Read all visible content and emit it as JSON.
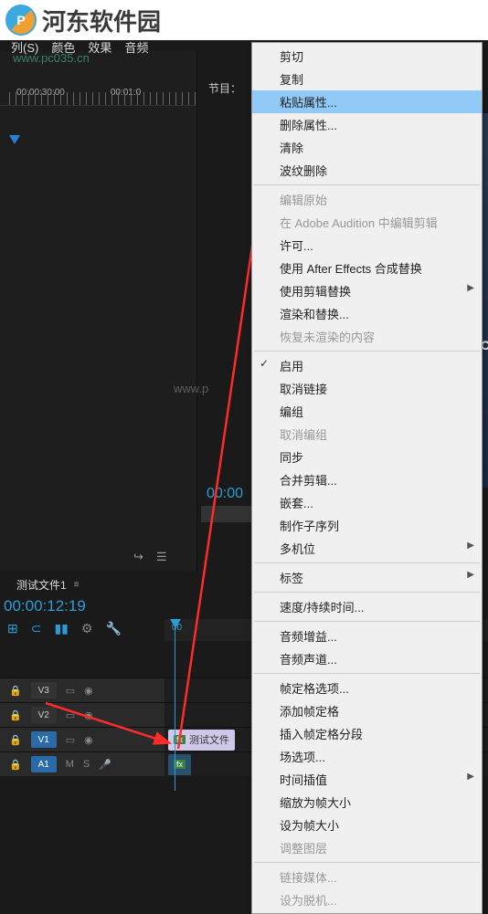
{
  "logo": {
    "text": "河东软件园"
  },
  "watermark": {
    "url1": "www.pc035.cn",
    "url2": "www.p"
  },
  "menubar": {
    "items": [
      "列(S)",
      "颜色",
      "效果",
      "音频"
    ]
  },
  "program": {
    "label": "节目："
  },
  "ruler": {
    "t1": "00:00:30:00",
    "t2": "00:01:0"
  },
  "big_time": "00:00",
  "sequence": {
    "tab": "测试文件1",
    "close": "≡"
  },
  "timeline": {
    "time": "00:00:12:19",
    "ruler0": "00"
  },
  "tracks": {
    "v3": "V3",
    "v2": "V2",
    "v1": "V1",
    "a1": "A1",
    "eye": "◉",
    "lock": "🔒",
    "m": "M",
    "s": "S",
    "mic": "🎤"
  },
  "clip": {
    "name": "测试文件",
    "fx": "fx"
  },
  "video_side": "C",
  "context_menu": {
    "items": [
      {
        "label": "剪切"
      },
      {
        "label": "复制"
      },
      {
        "label": "粘贴属性...",
        "hl": true
      },
      {
        "label": "删除属性..."
      },
      {
        "label": "清除"
      },
      {
        "label": "波纹删除"
      },
      {
        "sep": true
      },
      {
        "label": "编辑原始",
        "dis": true
      },
      {
        "label": "在 Adobe Audition 中编辑剪辑",
        "dis": true
      },
      {
        "label": "许可..."
      },
      {
        "label": "使用 After Effects 合成替换"
      },
      {
        "label": "使用剪辑替换",
        "sub": true
      },
      {
        "label": "渲染和替换..."
      },
      {
        "label": "恢复未渲染的内容",
        "dis": true
      },
      {
        "sep": true
      },
      {
        "label": "启用",
        "check": true
      },
      {
        "label": "取消链接"
      },
      {
        "label": "编组"
      },
      {
        "label": "取消编组",
        "dis": true
      },
      {
        "label": "同步"
      },
      {
        "label": "合并剪辑..."
      },
      {
        "label": "嵌套..."
      },
      {
        "label": "制作子序列"
      },
      {
        "label": "多机位",
        "sub": true
      },
      {
        "sep": true
      },
      {
        "label": "标签",
        "sub": true
      },
      {
        "sep": true
      },
      {
        "label": "速度/持续时间..."
      },
      {
        "sep": true
      },
      {
        "label": "音频增益..."
      },
      {
        "label": "音频声道..."
      },
      {
        "sep": true
      },
      {
        "label": "帧定格选项..."
      },
      {
        "label": "添加帧定格"
      },
      {
        "label": "插入帧定格分段"
      },
      {
        "label": "场选项..."
      },
      {
        "label": "时间插值",
        "sub": true
      },
      {
        "label": "缩放为帧大小"
      },
      {
        "label": "设为帧大小"
      },
      {
        "label": "调整图层",
        "dis": true
      },
      {
        "sep": true
      },
      {
        "label": "链接媒体...",
        "dis": true
      },
      {
        "label": "设为脱机...",
        "dis": true
      }
    ]
  }
}
